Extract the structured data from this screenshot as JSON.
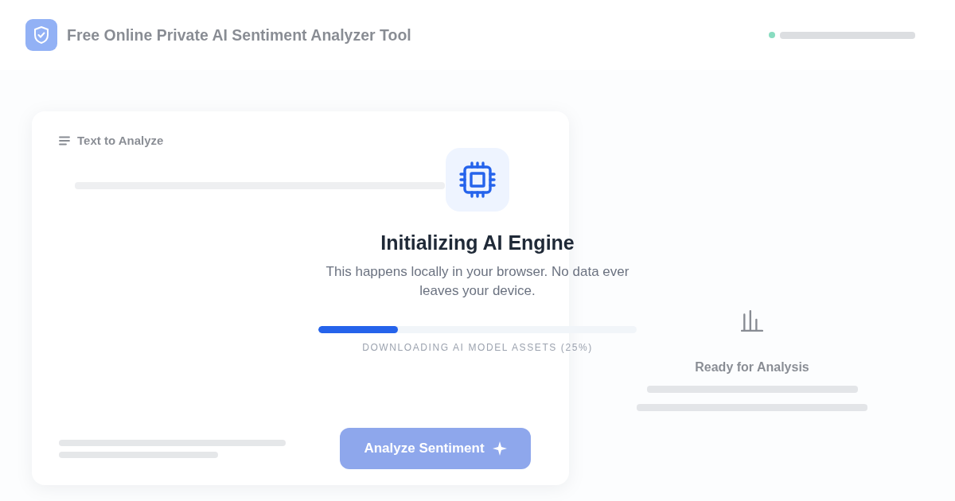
{
  "header": {
    "title": "Free Online Private AI Sentiment Analyzer Tool"
  },
  "input_card": {
    "heading": "Text to Analyze"
  },
  "analyze_button": {
    "label": "Analyze Sentiment"
  },
  "result_panel": {
    "heading": "Ready for Analysis"
  },
  "loading_overlay": {
    "title": "Initializing AI Engine",
    "message": "This happens locally in your browser. No data ever leaves your device.",
    "progress": {
      "level": 0.25,
      "label": "DOWNLOADING AI MODEL ASSETS (25%)"
    }
  }
}
